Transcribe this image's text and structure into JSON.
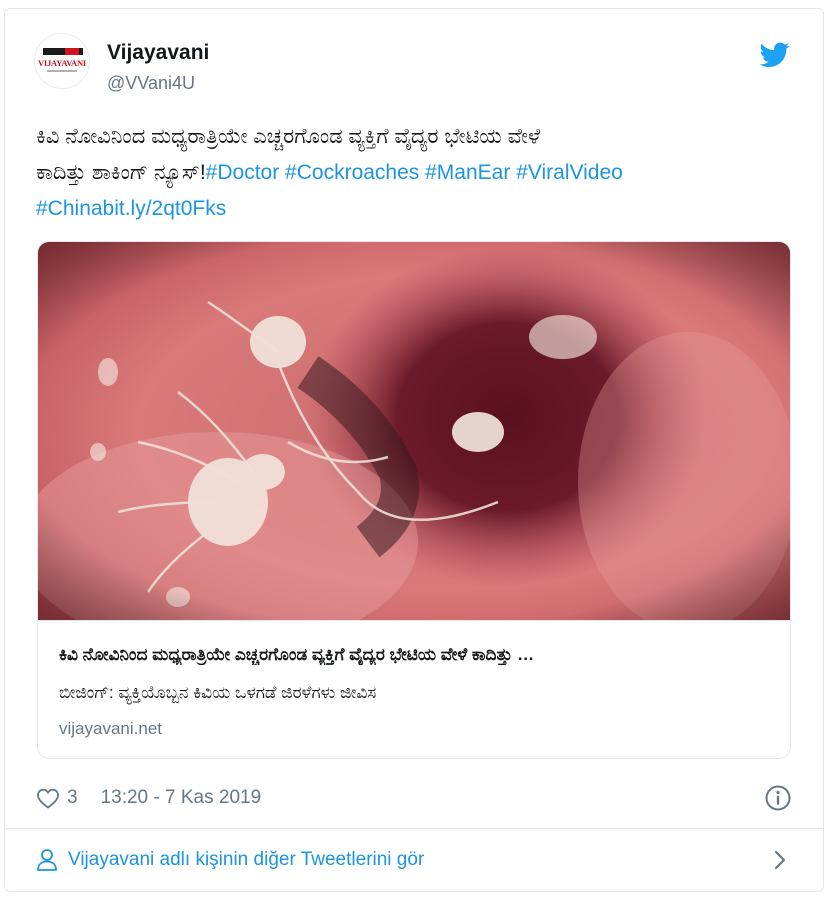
{
  "account": {
    "name": "Vijayavani",
    "handle": "@VVani4U",
    "avatar_logo_text": "VIJAYAVANI"
  },
  "tweet": {
    "text_line1": "ಕಿವಿ ನೋವಿನಿಂದ ಮಧ್ಯರಾತ್ರಿಯೇ ಎಚ್ಚರಗೊಂಡ ವ್ಯಕ್ತಿಗೆ ವೈದ್ಯರ ಭೇಟಿಯ ವೇಳೆ",
    "text_line2_plain": "ಕಾದಿತ್ತು ಶಾಕಿಂಗ್ ನ್ಯೂಸ್!",
    "hashtags": [
      "#Doctor",
      "#Cockroaches",
      "#ManEar",
      "#ViralVideo"
    ],
    "link_tag": "#Chinabit.ly/2qt0Fks"
  },
  "link_card": {
    "title": "ಕಿವಿ ನೋವಿನಿಂದ ಮಧ್ಯರಾತ್ರಿಯೇ ಎಚ್ಚರಗೊಂಡ ವ್ಯಕ್ತಿಗೆ ವೈದ್ಯರ ಭೇಟಿಯ ವೇಳೆ ಕಾದಿತ್ತು …",
    "description": "ಬೀಜಿಂಗ್: ವ್ಯಕ್ತಿಯೊಬ್ಬನ ಕಿವಿಯ ಒಳಗಡೆ ಜಿರಳೆಗಳು ಜೀವಿಸ",
    "domain": "vijayavani.net"
  },
  "meta": {
    "like_count": "3",
    "timestamp": "13:20 - 7 Kas 2019"
  },
  "footer": {
    "more_tweets_label": "Vijayavani adlı kişinin diğer Tweetlerini gör"
  },
  "colors": {
    "link_blue": "#1b95e0",
    "secondary_gray": "#657786",
    "twitter_blue": "#1da1f2",
    "border": "#e1e8ed"
  },
  "icons": [
    "twitter-bird-icon",
    "heart-icon",
    "info-icon",
    "person-icon",
    "chevron-right-icon"
  ]
}
